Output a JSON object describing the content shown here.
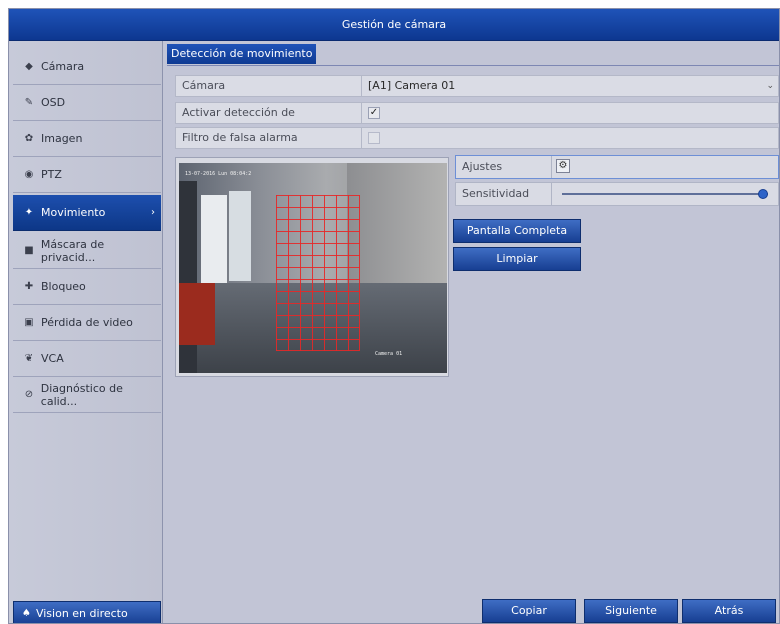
{
  "window": {
    "title": "Gestión de cámara"
  },
  "sidebar": {
    "items": [
      {
        "label": "Cámara",
        "icon": "camera-icon",
        "glyph": "◆"
      },
      {
        "label": "OSD",
        "icon": "osd-icon",
        "glyph": "✎"
      },
      {
        "label": "Imagen",
        "icon": "image-icon",
        "glyph": "✿"
      },
      {
        "label": "PTZ",
        "icon": "ptz-icon",
        "glyph": "◉"
      },
      {
        "label": "Movimiento",
        "icon": "motion-icon",
        "glyph": "✦",
        "active": true
      },
      {
        "label": "Máscara de privacid...",
        "icon": "privacy-mask-icon",
        "glyph": "■"
      },
      {
        "label": "Bloqueo",
        "icon": "tamper-icon",
        "glyph": "✚"
      },
      {
        "label": "Pérdida de video",
        "icon": "video-loss-icon",
        "glyph": "▣"
      },
      {
        "label": "VCA",
        "icon": "vca-icon",
        "glyph": "❦"
      },
      {
        "label": "Diagnóstico de calid...",
        "icon": "diagnostic-icon",
        "glyph": "⊘"
      }
    ],
    "live_label": "Vision en directo"
  },
  "tab": {
    "label": "Detección de movimiento"
  },
  "form": {
    "camera_label": "Cámara",
    "camera_value": "[A1] Camera 01",
    "enable_label": "Activar detección de movimiento",
    "enable_checked": true,
    "false_alarm_label": "Filtro de falsa alarma",
    "false_alarm_checked": false
  },
  "preview": {
    "timestamp": "13-07-2016 Lun 08:04:2",
    "camera_name": "Camera 01"
  },
  "controls": {
    "ajustes_label": "Ajustes",
    "sensitivity_label": "Sensitividad",
    "sensitivity_value": 100,
    "fullscreen_label": "Pantalla Completa",
    "clear_label": "Limpiar"
  },
  "footer": {
    "copy_label": "Copiar",
    "next_label": "Siguiente",
    "back_label": "Atrás"
  },
  "icons": {
    "checked_glyph": "✓",
    "gear_glyph": "⚙",
    "arrow_glyph": "›",
    "chevron_glyph": "⌄",
    "home_glyph": "♠"
  }
}
